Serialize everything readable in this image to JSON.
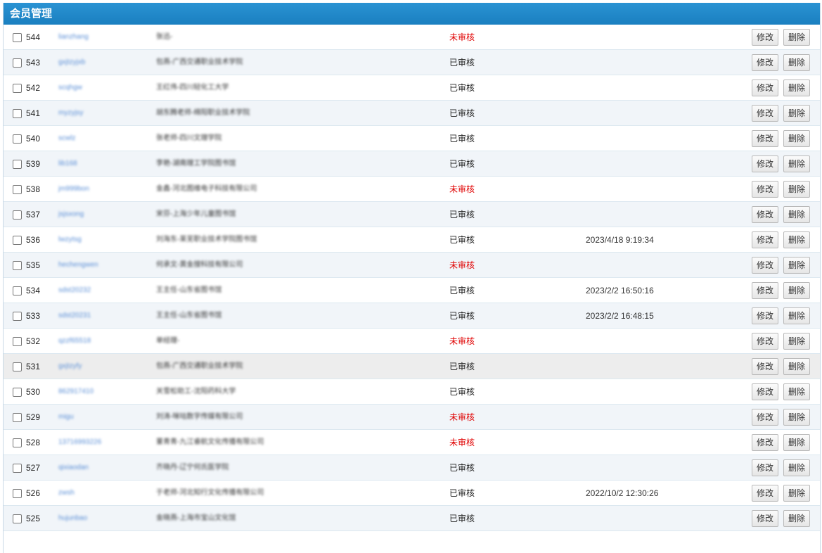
{
  "panel": {
    "title": "会员管理"
  },
  "actions": {
    "edit_label": "修改",
    "delete_label": "删除"
  },
  "colors": {
    "header": "#2288c9",
    "pending": "#e00000"
  },
  "rows": [
    {
      "id": "544",
      "username": "lianzhang",
      "name": "张迅-",
      "status": "未审核",
      "pending": true,
      "time": ""
    },
    {
      "id": "543",
      "username": "gxjtzyjxb",
      "name": "包燕-广西交通职业技术学院",
      "status": "已审核",
      "pending": false,
      "time": ""
    },
    {
      "id": "542",
      "username": "scqhgw",
      "name": "王红伟-四川轻化工大学",
      "status": "已审核",
      "pending": false,
      "time": ""
    },
    {
      "id": "541",
      "username": "myzyjsy",
      "name": "胡东腾老师-绵阳职业技术学院",
      "status": "已审核",
      "pending": false,
      "time": ""
    },
    {
      "id": "540",
      "username": "scwlz",
      "name": "张老师-四川文理学院",
      "status": "已审核",
      "pending": false,
      "time": ""
    },
    {
      "id": "539",
      "username": "lib168",
      "name": "李艳-湖南理工学院图书馆",
      "status": "已审核",
      "pending": false,
      "time": ""
    },
    {
      "id": "538",
      "username": "jm999bon",
      "name": "金鑫-河北图维电子科技有限公司",
      "status": "未审核",
      "pending": true,
      "time": ""
    },
    {
      "id": "537",
      "username": "jsjsxong",
      "name": "宋芬-上海少年儿童图书馆",
      "status": "已审核",
      "pending": false,
      "time": ""
    },
    {
      "id": "536",
      "username": "lwzytsg",
      "name": "刘海东-莱芜职业技术学院图书馆",
      "status": "已审核",
      "pending": false,
      "time": "2023/4/18 9:19:34"
    },
    {
      "id": "535",
      "username": "hechengwen",
      "name": "何承文-黄金搜科技有限公司",
      "status": "未审核",
      "pending": true,
      "time": ""
    },
    {
      "id": "534",
      "username": "sdst20232",
      "name": "王主任-山东省图书馆",
      "status": "已审核",
      "pending": false,
      "time": "2023/2/2 16:50:16"
    },
    {
      "id": "533",
      "username": "sdst20231",
      "name": "王主任-山东省图书馆",
      "status": "已审核",
      "pending": false,
      "time": "2023/2/2 16:48:15"
    },
    {
      "id": "532",
      "username": "qzzf65518",
      "name": "单经理-",
      "status": "未审核",
      "pending": true,
      "time": ""
    },
    {
      "id": "531",
      "username": "gxjtzyfy",
      "name": "包燕-广西交通职业技术学院",
      "status": "已审核",
      "pending": false,
      "time": ""
    },
    {
      "id": "530",
      "username": "862917410",
      "name": "关雪松助工-沈阳药科大学",
      "status": "已审核",
      "pending": false,
      "time": ""
    },
    {
      "id": "529",
      "username": "migu",
      "name": "刘涛-咪咕数字传媒有限公司",
      "status": "未审核",
      "pending": true,
      "time": ""
    },
    {
      "id": "528",
      "username": "13716993226",
      "name": "董青青-九江睿航文化传播有限公司",
      "status": "未审核",
      "pending": true,
      "time": ""
    },
    {
      "id": "527",
      "username": "qixiaodan",
      "name": "齐晓丹-辽宁何氏医学院",
      "status": "已审核",
      "pending": false,
      "time": ""
    },
    {
      "id": "526",
      "username": "zwsh",
      "name": "于老师-河北知行文化传播有限公司",
      "status": "已审核",
      "pending": false,
      "time": "2022/10/2 12:30:26"
    },
    {
      "id": "525",
      "username": "hujunbao",
      "name": "金晓燕-上海市宝山文化馆",
      "status": "已审核",
      "pending": false,
      "time": ""
    }
  ]
}
